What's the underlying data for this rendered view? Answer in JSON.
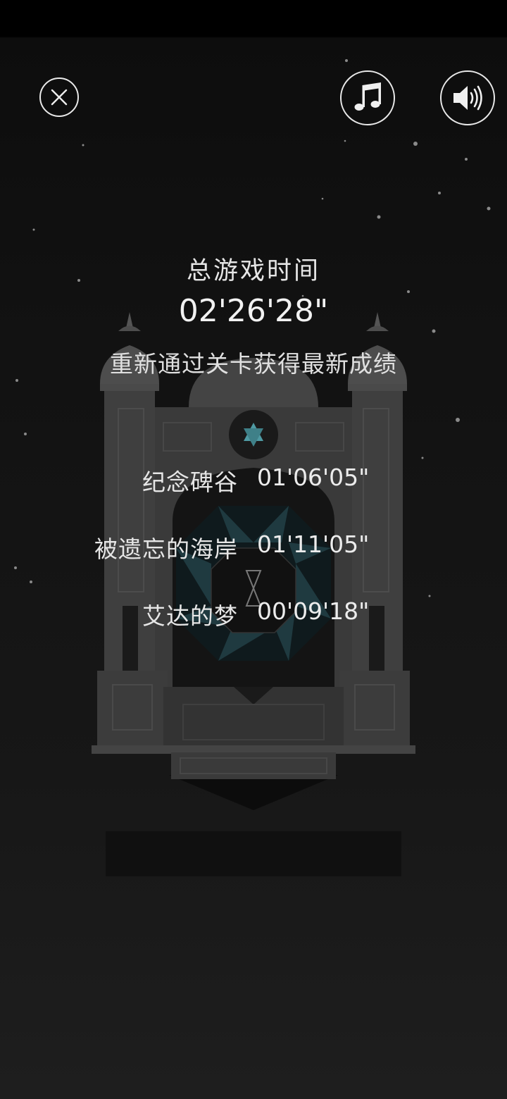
{
  "icons": {
    "close": "close-icon",
    "music": "music-note-icon",
    "sound": "speaker-icon"
  },
  "stats": {
    "total_label": "总游戏时间",
    "total_time": "02'26'28\"",
    "replay_hint": "重新通过关卡获得最新成绩"
  },
  "chapters": [
    {
      "name": "纪念碑谷",
      "time": "01'06'05\""
    },
    {
      "name": "被遗忘的海岸",
      "time": "01'11'05\""
    },
    {
      "name": "艾达的梦",
      "time": "00'09'18\""
    }
  ],
  "colors": {
    "background": "#111111",
    "text": "#e8e8e8",
    "temple": "#3a3a3a",
    "star_gem": "#4f9aa3"
  }
}
